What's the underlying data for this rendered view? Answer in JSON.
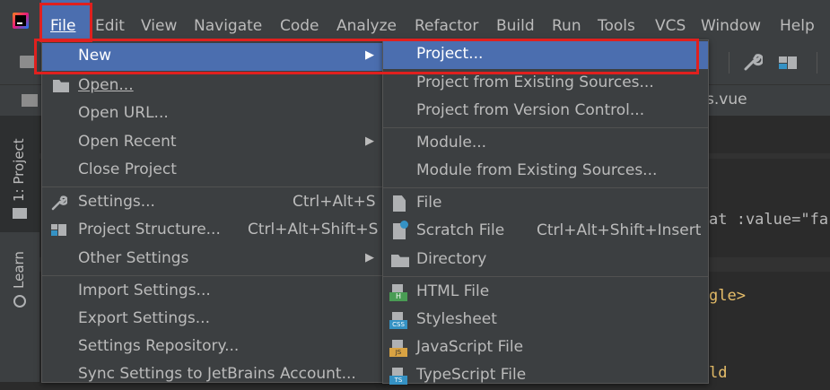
{
  "menubar": {
    "items": [
      {
        "label": "File"
      },
      {
        "label": "Edit"
      },
      {
        "label": "View"
      },
      {
        "label": "Navigate"
      },
      {
        "label": "Code"
      },
      {
        "label": "Analyze"
      },
      {
        "label": "Refactor"
      },
      {
        "label": "Build"
      },
      {
        "label": "Run"
      },
      {
        "label": "Tools"
      },
      {
        "label": "VCS"
      },
      {
        "label": "Window"
      },
      {
        "label": "Help"
      }
    ]
  },
  "editor": {
    "tab_fragment": "s.vue",
    "line1": "at :value=\"fa",
    "line2": "gle>",
    "line3": "ld"
  },
  "left_strip": {
    "project_label": "1: Project",
    "learn_label": "Learn"
  },
  "file_menu": {
    "new": "New",
    "open": "Open...",
    "open_url": "Open URL...",
    "open_recent": "Open Recent",
    "close_project": "Close Project",
    "settings": "Settings...",
    "settings_shortcut": "Ctrl+Alt+S",
    "project_structure": "Project Structure...",
    "project_structure_shortcut": "Ctrl+Alt+Shift+S",
    "other_settings": "Other Settings",
    "import_settings": "Import Settings...",
    "export_settings": "Export Settings...",
    "settings_repository": "Settings Repository...",
    "sync_settings": "Sync Settings to JetBrains Account..."
  },
  "new_submenu": {
    "project": "Project...",
    "project_existing": "Project from Existing Sources...",
    "project_vcs": "Project from Version Control...",
    "module": "Module...",
    "module_existing": "Module from Existing Sources...",
    "file": "File",
    "scratch_file": "Scratch File",
    "scratch_shortcut": "Ctrl+Alt+Shift+Insert",
    "directory": "Directory",
    "html_file": "HTML File",
    "stylesheet": "Stylesheet",
    "javascript_file": "JavaScript File",
    "typescript_file": "TypeScript File"
  },
  "colors": {
    "menu_bg": "#3c3f41",
    "selection": "#4b6eaf",
    "highlight_red": "#e0201e"
  }
}
